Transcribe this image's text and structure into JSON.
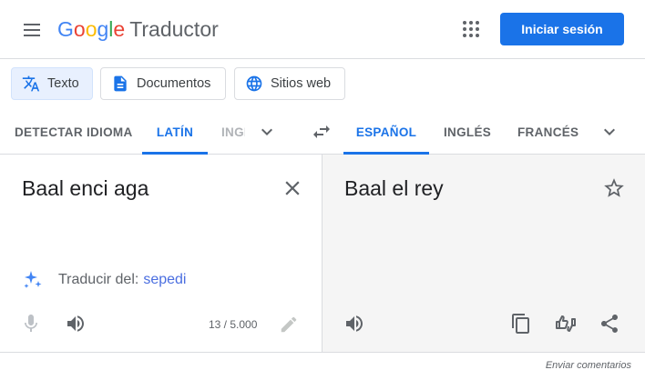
{
  "header": {
    "logo_letters": [
      "G",
      "o",
      "o",
      "g",
      "l",
      "e"
    ],
    "product_name": "Traductor",
    "signin_label": "Iniciar sesión",
    "icons": [
      "menu-icon",
      "apps-grid-icon"
    ]
  },
  "modes": [
    {
      "label": "Texto",
      "icon": "translate-icon",
      "active": true
    },
    {
      "label": "Documentos",
      "icon": "document-icon",
      "active": false
    },
    {
      "label": "Sitios web",
      "icon": "globe-icon",
      "active": false
    }
  ],
  "source_langs": {
    "detect": "DETECTAR IDIOMA",
    "active": "LATÍN",
    "truncated": "INGLÉS"
  },
  "target_langs": {
    "active": "ESPAÑOL",
    "second": "INGLÉS",
    "third": "FRANCÉS"
  },
  "source": {
    "text": "Baal enci aga",
    "suggestion_prefix": "Traducir del:",
    "suggestion_lang": "sepedi",
    "char_count": "13 / 5.000"
  },
  "target": {
    "text": "Baal el rey"
  },
  "footer": {
    "feedback": "Enviar comentarios"
  },
  "colors": {
    "accent": "#1a73e8",
    "target_panel_bg": "#f5f5f5",
    "suggestion_link": "#4a6ee0"
  }
}
